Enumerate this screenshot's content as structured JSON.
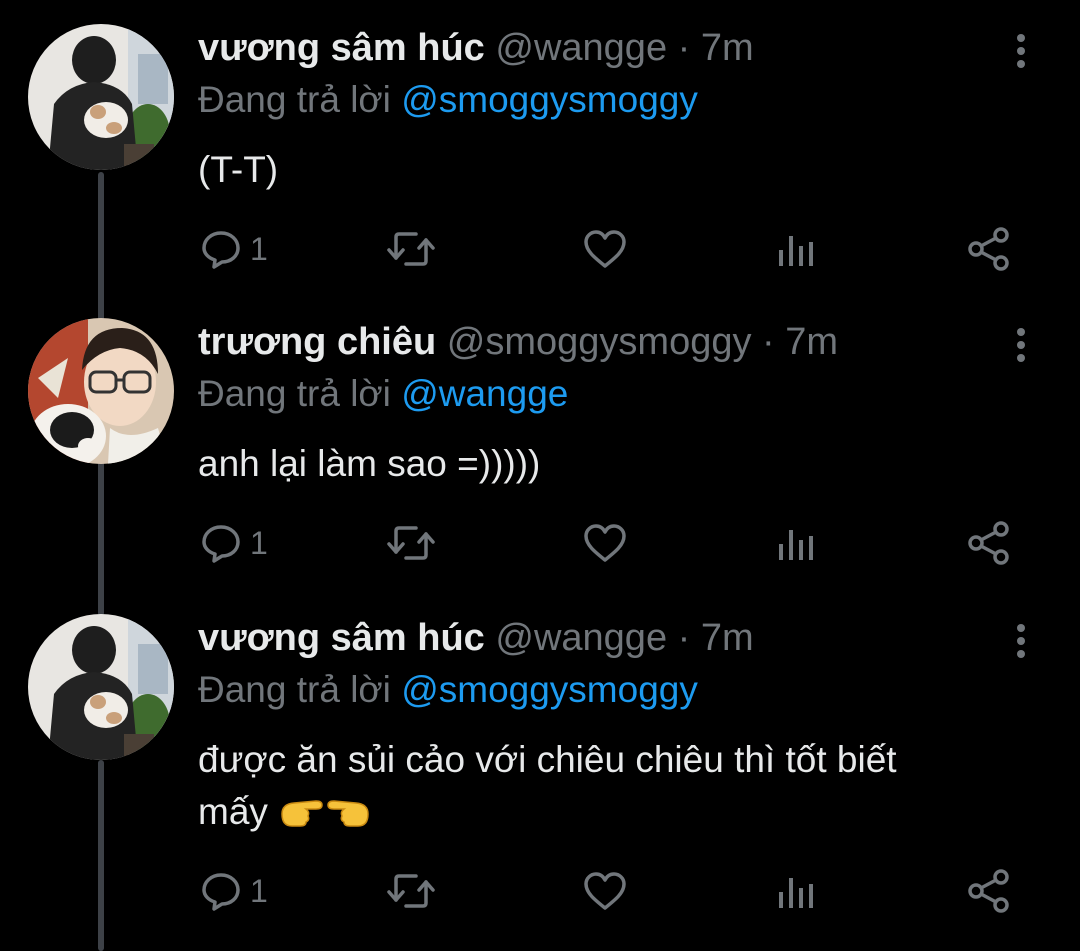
{
  "colors": {
    "background": "#000000",
    "primary_text": "#e7e9ea",
    "secondary_text": "#71767b",
    "mention": "#1d9bf0",
    "thread_line": "#3d4147"
  },
  "tweets": [
    {
      "display_name": "vương sâm húc",
      "handle": "@wangge",
      "separator": "·",
      "time": "7m",
      "replying_prefix": "Đang trả lời",
      "replying_to": "@smoggysmoggy",
      "text_lines": [
        "(T-T)"
      ],
      "text_emoji": "",
      "reply_count": "1",
      "avatar": "avatar-photo"
    },
    {
      "display_name": "trương chiêu",
      "handle": "@smoggysmoggy",
      "separator": "·",
      "time": "7m",
      "replying_prefix": "Đang trả lời",
      "replying_to": "@wangge",
      "text_lines": [
        "anh lại làm sao =)))))"
      ],
      "text_emoji": "",
      "reply_count": "1",
      "avatar": "avatar-photo"
    },
    {
      "display_name": "vương sâm húc",
      "handle": "@wangge",
      "separator": "·",
      "time": "7m",
      "replying_prefix": "Đang trả lời",
      "replying_to": "@smoggysmoggy",
      "text_lines": [
        "được ăn sủi cảo với chiêu chiêu thì tốt biết",
        "mấy"
      ],
      "text_emoji": "pointing-hands-emoji",
      "reply_count": "1",
      "avatar": "avatar-photo"
    }
  ],
  "icons": {
    "reply": "reply-icon",
    "retweet": "retweet-icon",
    "like": "heart-icon",
    "analytics": "analytics-icon",
    "share": "share-icon",
    "more": "more-vertical-icon"
  }
}
